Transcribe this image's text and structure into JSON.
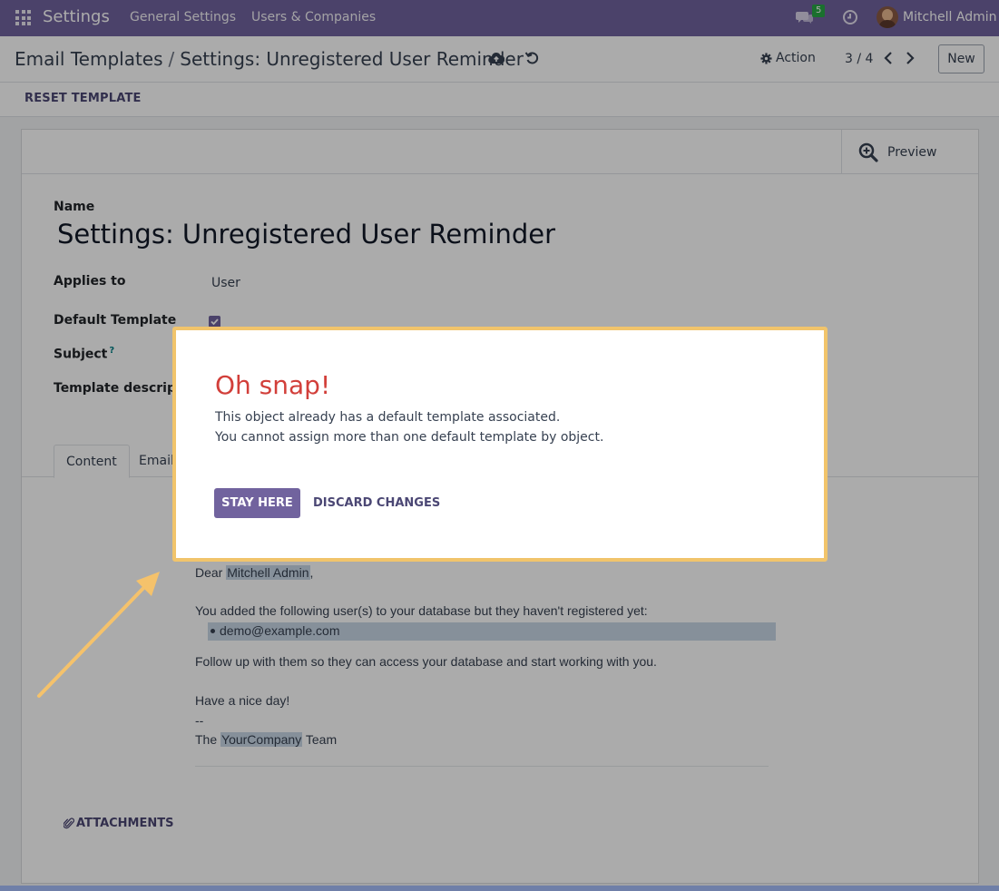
{
  "navbar": {
    "app_name": "Settings",
    "menu": [
      "General Settings",
      "Users & Companies"
    ],
    "chat_badge": "5",
    "user_name": "Mitchell Admin"
  },
  "control": {
    "breadcrumb_parent": "Email Templates",
    "breadcrumb_separator": "/",
    "breadcrumb_current": "Settings: Unregistered User Reminder",
    "action_label": "Action",
    "pager": "3 / 4",
    "new_label": "New"
  },
  "statusbar": {
    "reset_label": "RESET TEMPLATE"
  },
  "form": {
    "preview_label": "Preview",
    "name_label": "Name",
    "name_value": "Settings: Unregistered User Reminder",
    "applies_to_label": "Applies to",
    "applies_to_value": "User",
    "default_template_label": "Default Template",
    "default_template_checked": true,
    "subject_label": "Subject",
    "subject_help": "?",
    "description_label": "Template description",
    "tabs": [
      "Content",
      "Email"
    ]
  },
  "email_body": {
    "greeting": "Dear ",
    "recipient": "Mitchell Admin",
    "greeting_end": ",",
    "intro": "You added the following user(s) to your database but they haven't registered yet:",
    "pending_user": "demo@example.com",
    "follow_up": "Follow up with them so they can access your database and start working with you.",
    "closing": "Have a nice day!",
    "signature_dash": "--",
    "signature_pre": "The ",
    "company": "YourCompany",
    "signature_post": " Team"
  },
  "attachments_label": "ATTACHMENTS",
  "dialog": {
    "title": "Oh snap!",
    "line1": "This object already has a default template associated.",
    "line2": "You cannot assign more than one default template by object.",
    "stay_label": "STAY HERE",
    "discard_label": "DISCARD CHANGES"
  },
  "colors": {
    "brand": "#71639e",
    "dialog_title": "#d23f3a",
    "highlight_border": "#f1c46b",
    "annotation_arrow": "#f5c26b"
  }
}
